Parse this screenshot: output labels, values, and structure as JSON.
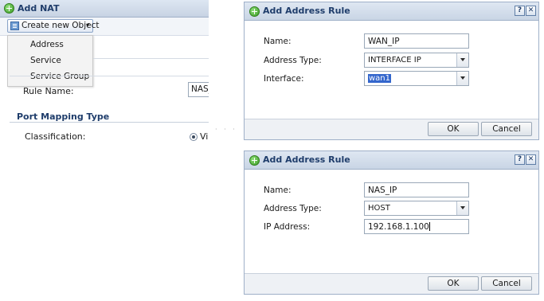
{
  "nat": {
    "title": "Add NAT",
    "create_button_label": "Create new Object",
    "create_button_caret": "▾",
    "menu": [
      {
        "label": "Address"
      },
      {
        "label": "Service"
      },
      {
        "label": "Service Group"
      }
    ],
    "rule_name_label": "Rule Name:",
    "rule_name_value": "NAS_",
    "section_title": "Port Mapping Type",
    "classification_label": "Classification:",
    "classification_value": "Vi",
    "icon": "add-circle-icon"
  },
  "dialog1": {
    "title": "Add Address Rule",
    "help": "?",
    "close": "✕",
    "name_label": "Name:",
    "name_value": "WAN_IP",
    "type_label": "Address Type:",
    "type_value": "INTERFACE IP",
    "interface_label": "Interface:",
    "interface_value": "wan1",
    "ok": "OK",
    "cancel": "Cancel"
  },
  "dialog2": {
    "title": "Add Address Rule",
    "help": "?",
    "close": "✕",
    "name_label": "Name:",
    "name_value": "NAS_IP",
    "type_label": "Address Type:",
    "type_value": "HOST",
    "ip_label": "IP Address:",
    "ip_value": "192.168.1.100",
    "ok": "OK",
    "cancel": "Cancel"
  },
  "colors": {
    "title_text": "#1f3d6b",
    "title_bar": "#c9d5e5",
    "selection": "#3366cc",
    "add_icon": "#3b9a24"
  }
}
